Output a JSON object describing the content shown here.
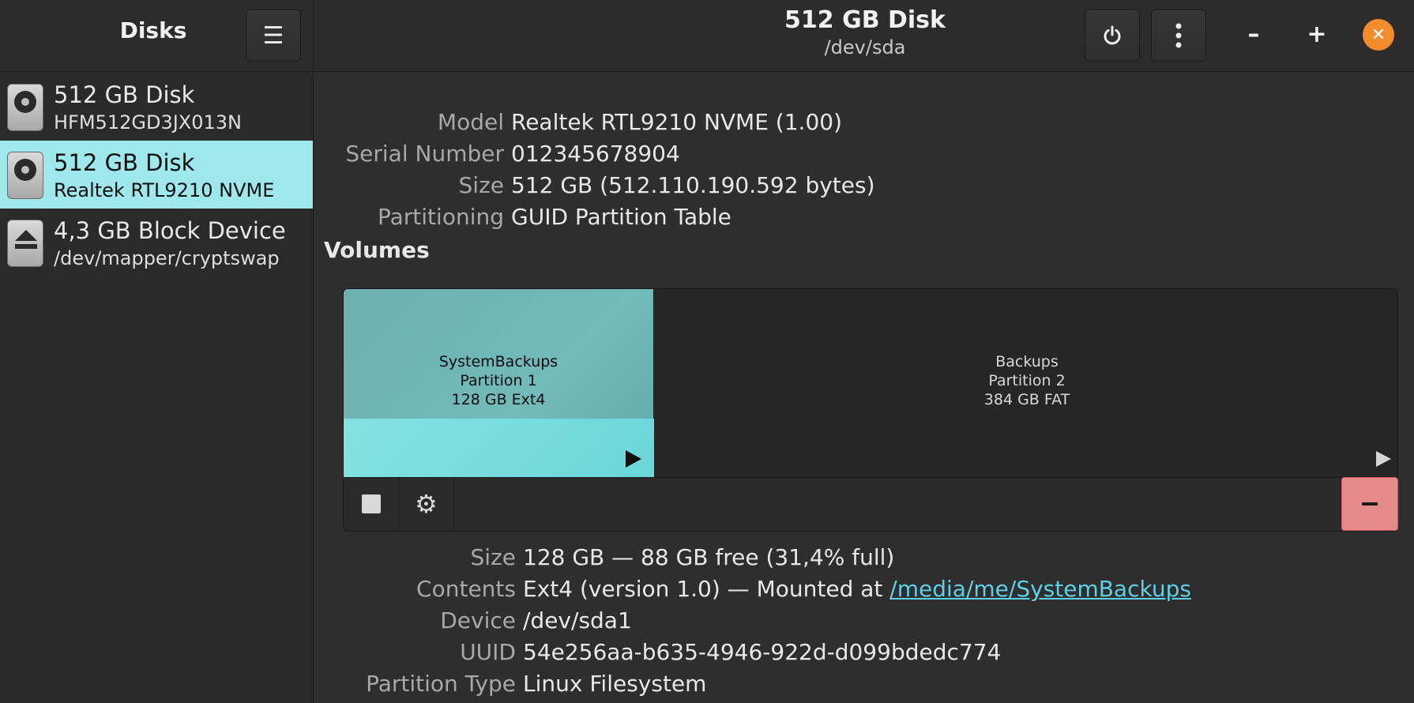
{
  "sidebar": {
    "title": "Disks",
    "devices": [
      {
        "name": "512 GB Disk",
        "sub": "HFM512GD3JX013N",
        "icon": "harddisk-icon"
      },
      {
        "name": "512 GB Disk",
        "sub": "Realtek RTL9210 NVME",
        "icon": "harddisk-icon",
        "selected": true
      },
      {
        "name": "4,3 GB Block Device",
        "sub": "/dev/mapper/cryptswap",
        "icon": "eject-icon"
      }
    ]
  },
  "header": {
    "title": "512 GB Disk",
    "subtitle": "/dev/sda",
    "menu_icon": "hamburger-menu-icon",
    "power_icon": "power-icon",
    "more_icon": "vertical-dots-icon",
    "minimize": "–",
    "maximize": "+",
    "close": "✕",
    "accent": "#f28c2c"
  },
  "disk_info": {
    "labels": {
      "model": "Model",
      "serial": "Serial Number",
      "size": "Size",
      "partitioning": "Partitioning"
    },
    "model": "Realtek RTL9210 NVME (1.00)",
    "serial": "012345678904",
    "size": "512 GB (512.110.190.592 bytes)",
    "partitioning": "GUID Partition Table"
  },
  "volumes": {
    "heading": "Volumes",
    "partitions": [
      {
        "name": "SystemBackups",
        "number": "Partition 1",
        "desc": "128 GB Ext4",
        "selected": true,
        "used_fraction": 0.314,
        "color": "#86e2e2"
      },
      {
        "name": "Backups",
        "number": "Partition 2",
        "desc": "384 GB FAT",
        "selected": false
      }
    ],
    "toolbar": {
      "stop_icon": "stop-square-icon",
      "settings_icon": "gears-icon",
      "delete_icon": "minus-icon",
      "delete_color": "#e68a8c"
    }
  },
  "partition_info": {
    "labels": {
      "size": "Size",
      "contents": "Contents",
      "device": "Device",
      "uuid": "UUID",
      "type": "Partition Type"
    },
    "size": "128 GB — 88 GB free (31,4% full)",
    "contents_prefix": "Ext4 (version 1.0) — Mounted at ",
    "mount_link": "/media/me/SystemBackups",
    "device": "/dev/sda1",
    "uuid": "54e256aa-b635-4946-922d-d099bdedc774",
    "type": "Linux Filesystem"
  }
}
